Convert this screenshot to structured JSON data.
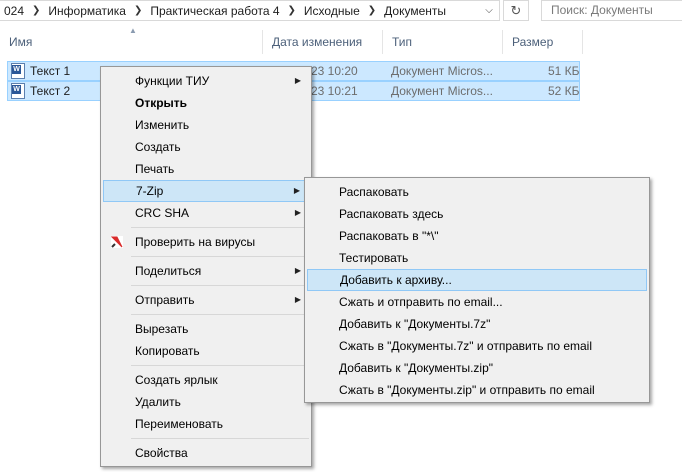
{
  "address": {
    "crumbs": [
      "024",
      "Информатика",
      "Практическая работа 4",
      "Исходные",
      "Документы"
    ],
    "search_placeholder": "Поиск: Документы"
  },
  "columns": {
    "name": "Имя",
    "date": "Дата изменения",
    "type": "Тип",
    "size": "Размер"
  },
  "files": [
    {
      "name": "Текст 1",
      "date": "23 10:20",
      "type": "Документ Micros...",
      "size": "51 КБ"
    },
    {
      "name": "Текст 2",
      "date": "23 10:21",
      "type": "Документ Micros...",
      "size": "52 КБ"
    }
  ],
  "context_menu": {
    "items": [
      "Функции ТИУ",
      "Открыть",
      "Изменить",
      "Создать",
      "Печать",
      "7-Zip",
      "CRC SHA",
      "Проверить на вирусы",
      "Поделиться",
      "Отправить",
      "Вырезать",
      "Копировать",
      "Создать ярлык",
      "Удалить",
      "Переименовать",
      "Свойства"
    ]
  },
  "zip_menu": {
    "items": [
      "Распаковать",
      "Распаковать здесь",
      "Распаковать в \"*\\\"",
      "Тестировать",
      "Добавить к архиву...",
      "Сжать и отправить по email...",
      "Добавить к \"Документы.7z\"",
      "Сжать в \"Документы.7z\" и отправить по email",
      "Добавить к \"Документы.zip\"",
      "Сжать в \"Документы.zip\" и отправить по email"
    ]
  },
  "colors": {
    "selection": "#cce8ff",
    "menu_highlight": "#cde6f7",
    "menu_bg": "#f0f0f0"
  }
}
